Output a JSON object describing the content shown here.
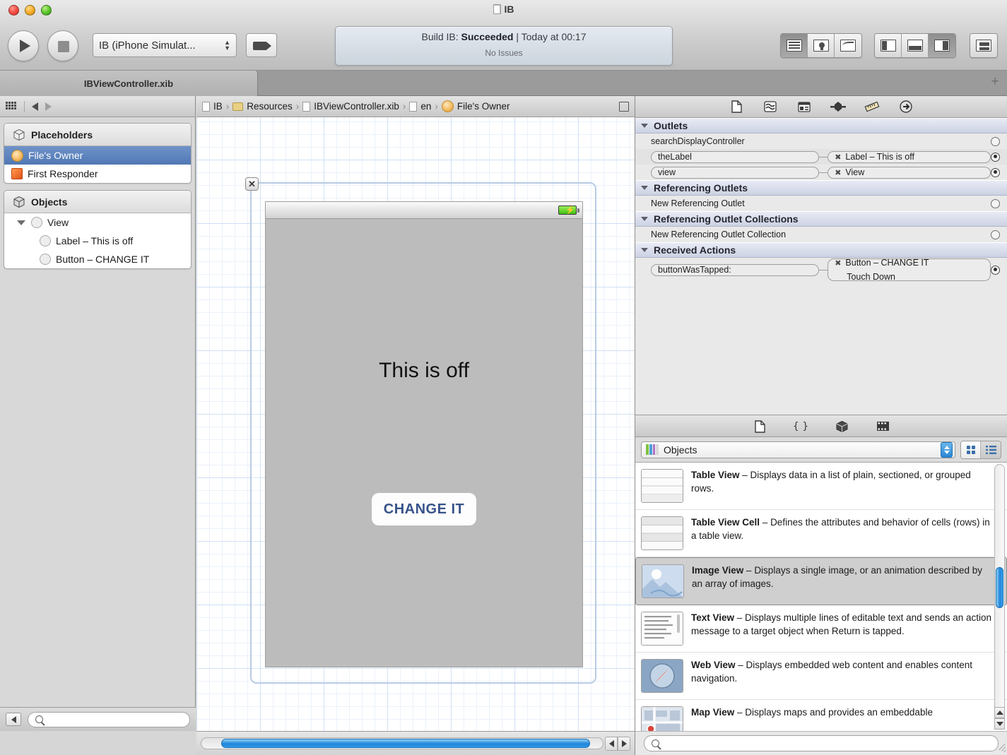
{
  "window": {
    "document_title": "IB",
    "traffic_lights": [
      "close-button",
      "minimize-button",
      "zoom-button"
    ]
  },
  "toolbar": {
    "run_label": "Run",
    "stop_label": "Stop",
    "scheme": "IB (iPhone Simulat...",
    "breakpoint_label": "Breakpoints",
    "status": {
      "prefix": "Build IB: ",
      "result": "Succeeded",
      "suffix": " | Today at 00:17",
      "issues": "No Issues"
    },
    "editor_segments": [
      "standard-editor",
      "assistant-editor",
      "version-editor"
    ],
    "view_segments": [
      "navigator-toggle",
      "debug-toggle",
      "utilities-toggle"
    ],
    "organizer": "organizer-button"
  },
  "tabs": {
    "active": "IBViewController.xib",
    "new_tab_label": "+"
  },
  "navigator": {
    "breadcrumb_toggle": "jump-bar-grid",
    "back_label": "◀",
    "forward_label": "▶",
    "groups": [
      {
        "title": "Placeholders",
        "items": [
          {
            "label": "File's Owner",
            "icon": "files-owner-icon",
            "selected": true,
            "indent": 0
          },
          {
            "label": "First Responder",
            "icon": "first-responder-icon",
            "selected": false,
            "indent": 0
          }
        ]
      },
      {
        "title": "Objects",
        "items": [
          {
            "label": "View",
            "icon": "view-icon",
            "selected": false,
            "indent": 0,
            "expanded": true
          },
          {
            "label": "Label – This is off",
            "icon": "label-icon",
            "selected": false,
            "indent": 1
          },
          {
            "label": "Button – CHANGE IT",
            "icon": "button-icon",
            "selected": false,
            "indent": 1
          }
        ]
      }
    ],
    "filter_placeholder": ""
  },
  "breadcrumb": {
    "items": [
      {
        "label": "IB",
        "icon": "project-icon"
      },
      {
        "label": "Resources",
        "icon": "folder-icon"
      },
      {
        "label": "IBViewController.xib",
        "icon": "file-icon"
      },
      {
        "label": "en",
        "icon": "file-icon"
      },
      {
        "label": "File's Owner",
        "icon": "files-owner-icon"
      }
    ],
    "separator": "›",
    "minimize_label": "hide-jump-bar"
  },
  "canvas": {
    "close_badge": "✕",
    "label_text": "This is off",
    "button_text": "CHANGE IT",
    "battery_icon": "battery-charging-icon",
    "scroll_left_arrow": "◀",
    "scroll_right_arrow": "▶"
  },
  "inspector": {
    "tabs": [
      "file-inspector",
      "quick-help-inspector",
      "identity-inspector",
      "attributes-inspector",
      "size-inspector",
      "connections-inspector"
    ],
    "active_tab": "connections-inspector",
    "sections": [
      {
        "title": "Outlets",
        "rows": [
          {
            "name": "searchDisplayController",
            "connected": false,
            "target": null,
            "event": null
          },
          {
            "name": "theLabel",
            "connected": true,
            "target": "Label – This is off",
            "event": null
          },
          {
            "name": "view",
            "connected": true,
            "target": "View",
            "event": null
          }
        ]
      },
      {
        "title": "Referencing Outlets",
        "rows": [
          {
            "name": "New Referencing Outlet",
            "connected": false,
            "target": null,
            "event": null
          }
        ]
      },
      {
        "title": "Referencing Outlet Collections",
        "rows": [
          {
            "name": "New Referencing Outlet Collection",
            "connected": false,
            "target": null,
            "event": null
          }
        ]
      },
      {
        "title": "Received Actions",
        "rows": [
          {
            "name": "buttonWasTapped:",
            "connected": true,
            "target": "Button – CHANGE IT",
            "event": "Touch Down"
          }
        ]
      }
    ]
  },
  "library": {
    "tabs": [
      "file-template-library",
      "code-snippet-library",
      "object-library",
      "media-library"
    ],
    "active_tab": "object-library",
    "selector_value": "Objects",
    "view_modes": [
      "grid-view",
      "list-view"
    ],
    "active_view_mode": "list-view",
    "search_placeholder": "",
    "items": [
      {
        "title": "Table View",
        "dash": " – ",
        "desc": "Displays data in a list of plain, sectioned, or grouped rows.",
        "icon": "table-view-icon",
        "selected": false
      },
      {
        "title": "Table View Cell",
        "dash": " – ",
        "desc": "Defines the attributes and behavior of cells (rows) in a table view.",
        "icon": "table-view-cell-icon",
        "selected": false
      },
      {
        "title": "Image View",
        "dash": " – ",
        "desc": "Displays a single image, or an animation described by an array of images.",
        "icon": "image-view-icon",
        "selected": true
      },
      {
        "title": "Text View",
        "dash": " – ",
        "desc": "Displays multiple lines of editable text and sends an action message to a target object when Return is tapped.",
        "icon": "text-view-icon",
        "selected": false
      },
      {
        "title": "Web View",
        "dash": " – ",
        "desc": "Displays embedded web content and enables content navigation.",
        "icon": "web-view-icon",
        "selected": false
      },
      {
        "title": "Map View",
        "dash": " – ",
        "desc": "Displays maps and provides an embeddable",
        "icon": "map-view-icon",
        "selected": false
      }
    ]
  },
  "colors": {
    "selection_blue": "#5078b4",
    "scrollbar_blue": "#1f85d8",
    "button_text": "#38538a",
    "canvas_grid": "#cfe0f5"
  }
}
